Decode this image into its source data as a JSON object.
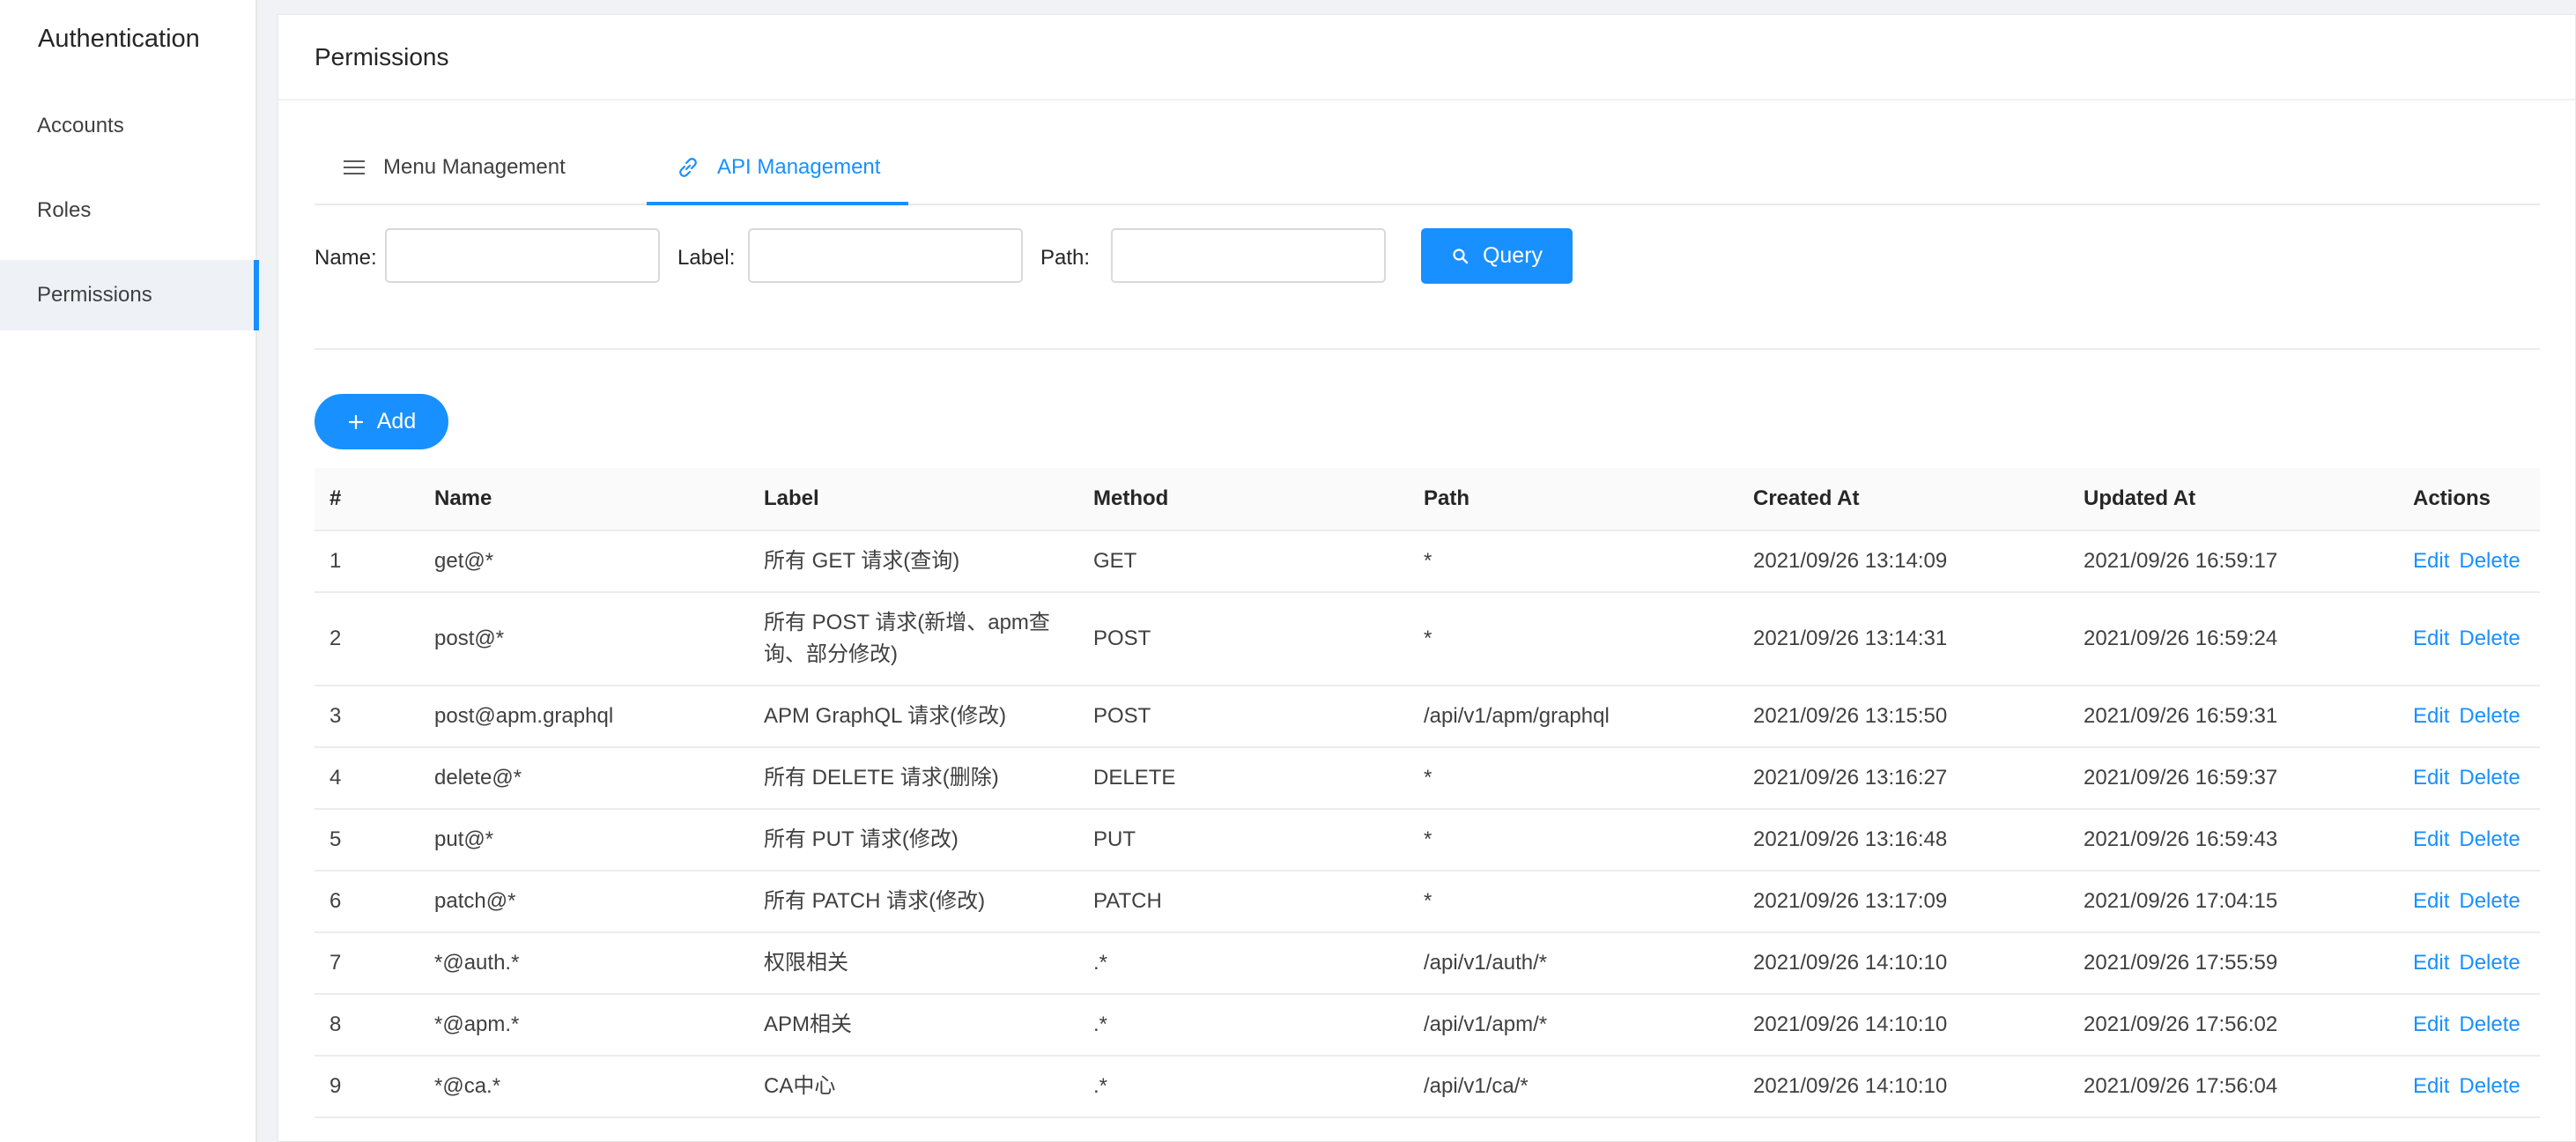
{
  "sidebar": {
    "title": "Authentication",
    "items": [
      {
        "label": "Accounts"
      },
      {
        "label": "Roles"
      },
      {
        "label": "Permissions"
      }
    ]
  },
  "header": {
    "title": "Permissions"
  },
  "tabs": [
    {
      "label": "Menu Management",
      "icon": "menu-icon"
    },
    {
      "label": "API Management",
      "icon": "link-icon"
    }
  ],
  "search": {
    "name_label": "Name:",
    "name_value": "",
    "label_label": "Label:",
    "label_value": "",
    "path_label": "Path:",
    "path_value": "",
    "query_label": "Query"
  },
  "toolbar": {
    "add_label": "Add"
  },
  "table": {
    "columns": [
      "#",
      "Name",
      "Label",
      "Method",
      "Path",
      "Created At",
      "Updated At",
      "Actions"
    ],
    "edit_label": "Edit",
    "delete_label": "Delete",
    "rows": [
      {
        "id": "1",
        "name": "get@*",
        "label": "所有 GET 请求(查询)",
        "method": "GET",
        "path": "*",
        "created": "2021/09/26 13:14:09",
        "updated": "2021/09/26 16:59:17"
      },
      {
        "id": "2",
        "name": "post@*",
        "label": "所有 POST 请求(新增、apm查询、部分修改)",
        "method": "POST",
        "path": "*",
        "created": "2021/09/26 13:14:31",
        "updated": "2021/09/26 16:59:24"
      },
      {
        "id": "3",
        "name": "post@apm.graphql",
        "label": "APM GraphQL 请求(修改)",
        "method": "POST",
        "path": "/api/v1/apm/graphql",
        "created": "2021/09/26 13:15:50",
        "updated": "2021/09/26 16:59:31"
      },
      {
        "id": "4",
        "name": "delete@*",
        "label": "所有 DELETE 请求(删除)",
        "method": "DELETE",
        "path": "*",
        "created": "2021/09/26 13:16:27",
        "updated": "2021/09/26 16:59:37"
      },
      {
        "id": "5",
        "name": "put@*",
        "label": "所有 PUT 请求(修改)",
        "method": "PUT",
        "path": "*",
        "created": "2021/09/26 13:16:48",
        "updated": "2021/09/26 16:59:43"
      },
      {
        "id": "6",
        "name": "patch@*",
        "label": "所有 PATCH 请求(修改)",
        "method": "PATCH",
        "path": "*",
        "created": "2021/09/26 13:17:09",
        "updated": "2021/09/26 17:04:15"
      },
      {
        "id": "7",
        "name": "*@auth.*",
        "label": "权限相关",
        "method": ".*",
        "path": "/api/v1/auth/*",
        "created": "2021/09/26 14:10:10",
        "updated": "2021/09/26 17:55:59"
      },
      {
        "id": "8",
        "name": "*@apm.*",
        "label": "APM相关",
        "method": ".*",
        "path": "/api/v1/apm/*",
        "created": "2021/09/26 14:10:10",
        "updated": "2021/09/26 17:56:02"
      },
      {
        "id": "9",
        "name": "*@ca.*",
        "label": "CA中心",
        "method": ".*",
        "path": "/api/v1/ca/*",
        "created": "2021/09/26 14:10:10",
        "updated": "2021/09/26 17:56:04"
      }
    ]
  },
  "colors": {
    "accent": "#1890ff",
    "active_bg": "#eef2f7"
  }
}
